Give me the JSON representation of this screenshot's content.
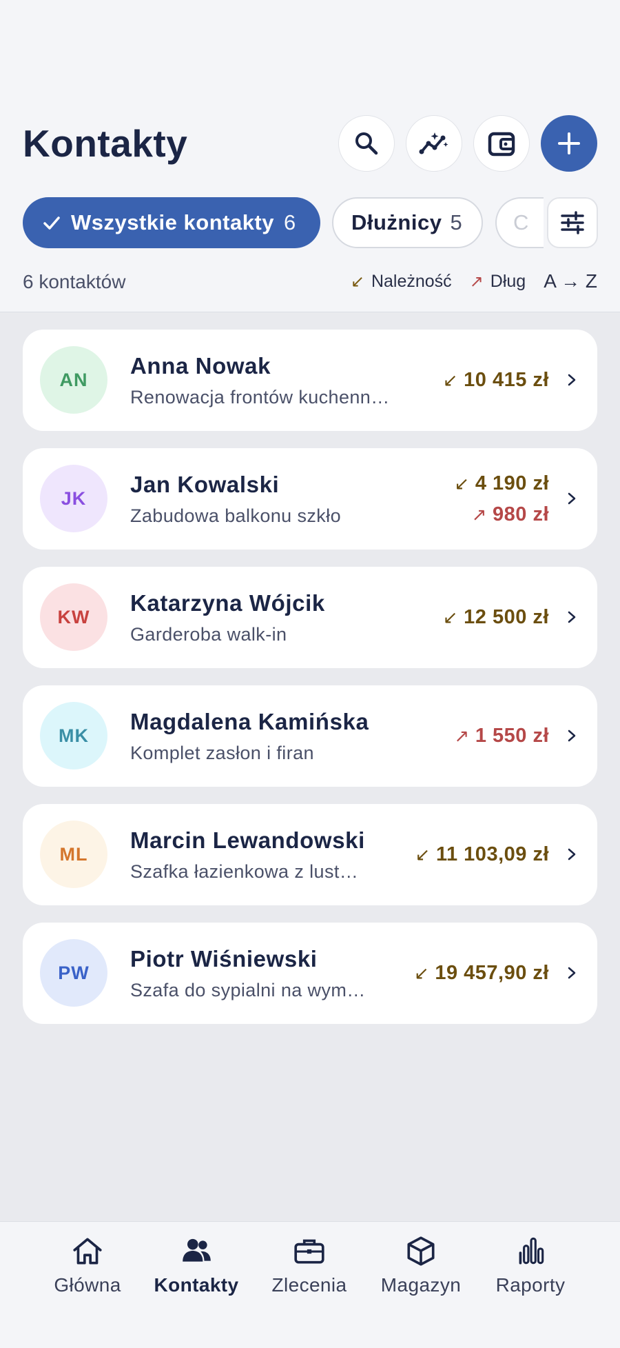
{
  "header": {
    "title": "Kontakty",
    "icons": [
      "search-icon",
      "trend-sparkle-icon",
      "wallet-icon",
      "plus-icon"
    ]
  },
  "filters": {
    "active": {
      "label": "Wszystkie kontakty",
      "count": "6"
    },
    "second": {
      "label": "Dłużnicy",
      "count": "5"
    },
    "third": {
      "label": "C"
    }
  },
  "summary": {
    "count_text": "6 kontaktów",
    "legend_receivable": "Należność",
    "legend_debt": "Dług",
    "sort": "A → Z",
    "arrow_receivable": "↙",
    "arrow_debt": "↗"
  },
  "contacts": [
    {
      "initials": "AN",
      "name": "Anna Nowak",
      "desc": "Renowacja frontów kuchenn…",
      "amounts": [
        {
          "type": "receivable",
          "arrow": "↙",
          "value": "10 415 zł"
        }
      ],
      "avatar_bg": "#dff5e6",
      "avatar_fg": "#3f9a62"
    },
    {
      "initials": "JK",
      "name": "Jan Kowalski",
      "desc": "Zabudowa balkonu szkło",
      "amounts": [
        {
          "type": "receivable",
          "arrow": "↙",
          "value": "4 190 zł"
        },
        {
          "type": "debt",
          "arrow": "↗",
          "value": "980 zł"
        }
      ],
      "avatar_bg": "#efe6fd",
      "avatar_fg": "#8a4fe0"
    },
    {
      "initials": "KW",
      "name": "Katarzyna Wójcik",
      "desc": "Garderoba walk-in",
      "amounts": [
        {
          "type": "receivable",
          "arrow": "↙",
          "value": "12 500 zł"
        }
      ],
      "avatar_bg": "#fbe1e3",
      "avatar_fg": "#c8423f"
    },
    {
      "initials": "MK",
      "name": "Magdalena Kamińska",
      "desc": "Komplet zasłon i firan",
      "amounts": [
        {
          "type": "debt",
          "arrow": "↗",
          "value": "1 550 zł"
        }
      ],
      "avatar_bg": "#dcf6fb",
      "avatar_fg": "#3a8fa6"
    },
    {
      "initials": "ML",
      "name": "Marcin Lewandowski",
      "desc": "Szafka łazienkowa z lust…",
      "amounts": [
        {
          "type": "receivable",
          "arrow": "↙",
          "value": "11 103,09 zł"
        }
      ],
      "avatar_bg": "#fdf4e6",
      "avatar_fg": "#d4762c"
    },
    {
      "initials": "PW",
      "name": "Piotr Wiśniewski",
      "desc": "Szafa do sypialni na wym…",
      "amounts": [
        {
          "type": "receivable",
          "arrow": "↙",
          "value": "19 457,90 zł"
        }
      ],
      "avatar_bg": "#e1e9fb",
      "avatar_fg": "#3a62c8"
    }
  ],
  "nav": [
    {
      "label": "Główna",
      "icon": "home-icon",
      "active": false
    },
    {
      "label": "Kontakty",
      "icon": "people-icon",
      "active": true
    },
    {
      "label": "Zlecenia",
      "icon": "briefcase-icon",
      "active": false
    },
    {
      "label": "Magazyn",
      "icon": "box-icon",
      "active": false
    },
    {
      "label": "Raporty",
      "icon": "bar-chart-icon",
      "active": false
    }
  ],
  "colors": {
    "accent": "#3a62b0",
    "receivable": "#6b4e0f",
    "debt": "#b54848"
  }
}
